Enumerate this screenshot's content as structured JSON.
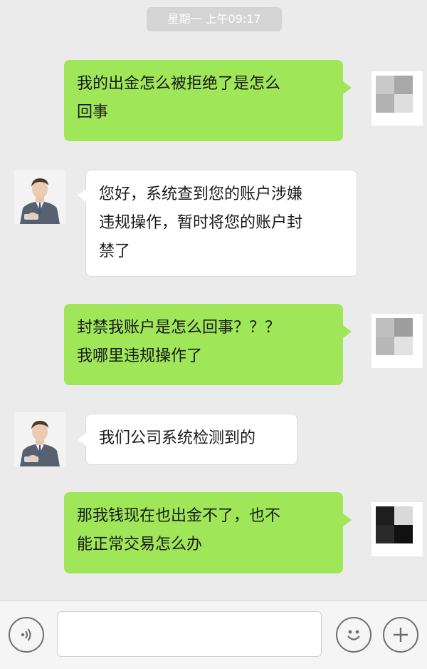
{
  "header": {
    "timestamp": "星期一 上午09:17"
  },
  "messages": [
    {
      "from": "me",
      "text": "我的出金怎么被拒绝了是怎么\n回事"
    },
    {
      "from": "agent",
      "text": "您好，系统查到您的账户涉嫌\n违规操作，暂时将您的账户封\n禁了"
    },
    {
      "from": "me",
      "text": "封禁我账户是怎么回事？？？\n我哪里违规操作了"
    },
    {
      "from": "agent",
      "text": "我们公司系统检测到的"
    },
    {
      "from": "me",
      "text": "那我钱现在也出金不了，也不\n能正常交易怎么办"
    }
  ],
  "colors": {
    "sent_bubble": "#9fe658",
    "received_bubble": "#ffffff",
    "background": "#ebebeb"
  },
  "input_bar": {
    "voice_icon": "voice-icon",
    "emoji_icon": "emoji-icon",
    "plus_icon": "plus-icon",
    "text_value": ""
  }
}
